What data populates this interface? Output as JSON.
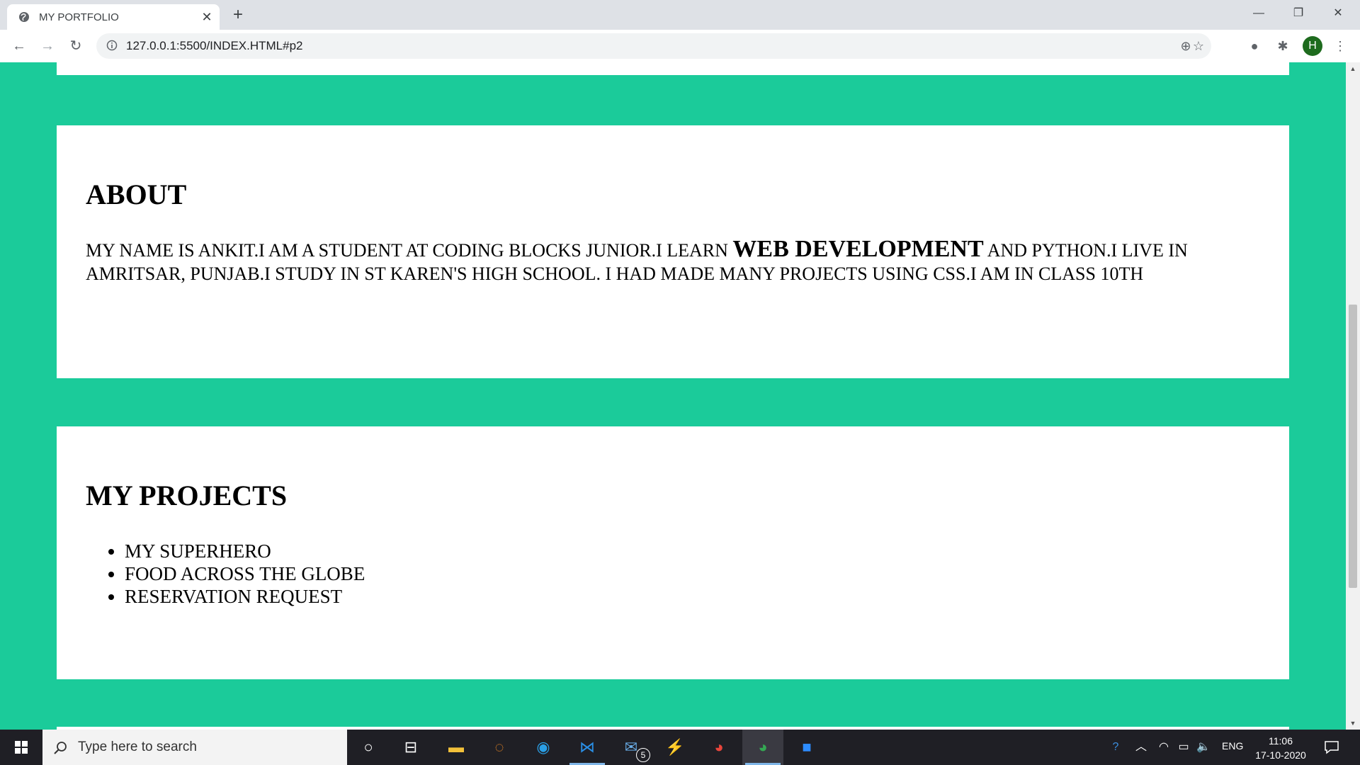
{
  "browser": {
    "tab_title": "MY PORTFOLIO",
    "url": "127.0.0.1:5500/INDEX.HTML#p2",
    "profile_initial": "H"
  },
  "about": {
    "heading": "ABOUT",
    "text_before": "MY NAME IS ANKIT.I AM A STUDENT AT CODING BLOCKS JUNIOR.I LEARN ",
    "text_bold": "WEB DEVELOPMENT",
    "text_after": " AND PYTHON.I LIVE IN AMRITSAR, PUNJAB.I STUDY IN ST KAREN'S HIGH SCHOOL. I HAD MADE MANY PROJECTS USING CSS.I AM IN CLASS 10TH"
  },
  "projects": {
    "heading": "MY PROJECTS",
    "items": [
      "MY SUPERHERO",
      "FOOD ACROSS THE GLOBE",
      "RESERVATION REQUEST"
    ]
  },
  "taskbar": {
    "search_placeholder": "Type here to search",
    "mail_badge": "5",
    "language": "ENG",
    "time": "11:06",
    "date": "17-10-2020"
  },
  "colors": {
    "page_background": "#1bcb9a",
    "card_background": "#ffffff"
  }
}
